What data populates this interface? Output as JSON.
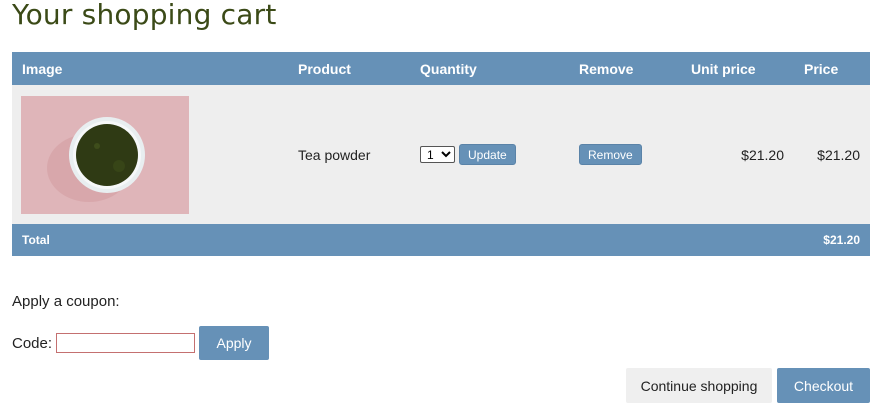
{
  "page": {
    "title": "Your shopping cart"
  },
  "cart": {
    "headers": {
      "image": "Image",
      "product": "Product",
      "quantity": "Quantity",
      "remove": "Remove",
      "unit_price": "Unit price",
      "price": "Price"
    },
    "items": [
      {
        "product": "Tea powder",
        "quantity": "1",
        "update_label": "Update",
        "remove_label": "Remove",
        "unit_price": "$21.20",
        "price": "$21.20"
      }
    ],
    "total_label": "Total",
    "total": "$21.20"
  },
  "coupon": {
    "heading": "Apply a coupon:",
    "code_label": "Code:",
    "code_value": "",
    "apply_label": "Apply"
  },
  "actions": {
    "continue_label": "Continue shopping",
    "checkout_label": "Checkout"
  },
  "colors": {
    "accent": "#6691b7",
    "title": "#3b4a17",
    "row_bg": "#eeeeee"
  }
}
